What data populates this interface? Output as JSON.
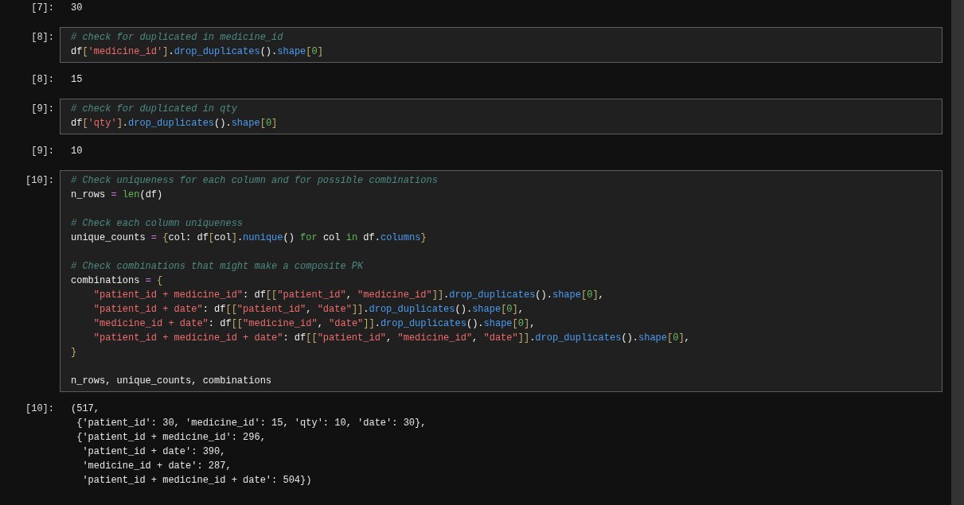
{
  "cells": [
    {
      "kind": "output",
      "prompt": "[7]:",
      "lines": [
        "30"
      ]
    },
    {
      "kind": "input",
      "prompt": "[8]:",
      "blocks": [
        {
          "lines": [
            {
              "tokens": [
                {
                  "kind": "comment",
                  "text": "# check for duplicated in medicine_id"
                }
              ]
            },
            {
              "tokens": [
                {
                  "kind": "name",
                  "text": "df"
                },
                {
                  "kind": "bracket",
                  "text": "["
                },
                {
                  "kind": "string",
                  "text": "'medicine_id'"
                },
                {
                  "kind": "bracket",
                  "text": "]"
                },
                {
                  "kind": "name",
                  "text": "."
                },
                {
                  "kind": "attr",
                  "text": "drop_duplicates"
                },
                {
                  "kind": "name",
                  "text": "()."
                },
                {
                  "kind": "attr",
                  "text": "shape"
                },
                {
                  "kind": "bracket",
                  "text": "["
                },
                {
                  "kind": "number",
                  "text": "0"
                },
                {
                  "kind": "bracket",
                  "text": "]"
                }
              ]
            }
          ]
        }
      ]
    },
    {
      "kind": "output",
      "prompt": "[8]:",
      "lines": [
        "15"
      ]
    },
    {
      "kind": "input",
      "prompt": "[9]:",
      "blocks": [
        {
          "lines": [
            {
              "tokens": [
                {
                  "kind": "comment",
                  "text": "# check for duplicated in qty"
                }
              ]
            },
            {
              "tokens": [
                {
                  "kind": "name",
                  "text": "df"
                },
                {
                  "kind": "bracket",
                  "text": "["
                },
                {
                  "kind": "string",
                  "text": "'qty'"
                },
                {
                  "kind": "bracket",
                  "text": "]"
                },
                {
                  "kind": "name",
                  "text": "."
                },
                {
                  "kind": "attr",
                  "text": "drop_duplicates"
                },
                {
                  "kind": "name",
                  "text": "()."
                },
                {
                  "kind": "attr",
                  "text": "shape"
                },
                {
                  "kind": "bracket",
                  "text": "["
                },
                {
                  "kind": "number",
                  "text": "0"
                },
                {
                  "kind": "bracket",
                  "text": "]"
                }
              ]
            }
          ]
        }
      ]
    },
    {
      "kind": "output",
      "prompt": "[9]:",
      "lines": [
        "10"
      ]
    },
    {
      "kind": "input",
      "prompt": "[10]:",
      "blocks": [
        {
          "lines": [
            {
              "tokens": [
                {
                  "kind": "comment",
                  "text": "# Check uniqueness for each column and for possible combinations"
                }
              ]
            },
            {
              "tokens": [
                {
                  "kind": "name",
                  "text": "n_rows "
                },
                {
                  "kind": "operator",
                  "text": "= "
                },
                {
                  "kind": "builtin",
                  "text": "len"
                },
                {
                  "kind": "name",
                  "text": "(df)"
                }
              ]
            }
          ]
        },
        {
          "lines": [
            {
              "tokens": [
                {
                  "kind": "comment",
                  "text": "# Check each column uniqueness"
                }
              ]
            },
            {
              "tokens": [
                {
                  "kind": "name",
                  "text": "unique_counts "
                },
                {
                  "kind": "operator",
                  "text": "= "
                },
                {
                  "kind": "bracket",
                  "text": "{"
                },
                {
                  "kind": "name",
                  "text": "col: df"
                },
                {
                  "kind": "bracket",
                  "text": "["
                },
                {
                  "kind": "name",
                  "text": "col"
                },
                {
                  "kind": "bracket",
                  "text": "]"
                },
                {
                  "kind": "name",
                  "text": "."
                },
                {
                  "kind": "attr",
                  "text": "nunique"
                },
                {
                  "kind": "name",
                  "text": "() "
                },
                {
                  "kind": "keyword",
                  "text": "for"
                },
                {
                  "kind": "name",
                  "text": " col "
                },
                {
                  "kind": "keyword",
                  "text": "in"
                },
                {
                  "kind": "name",
                  "text": " df."
                },
                {
                  "kind": "attr",
                  "text": "columns"
                },
                {
                  "kind": "bracket",
                  "text": "}"
                }
              ]
            }
          ]
        },
        {
          "lines": [
            {
              "tokens": [
                {
                  "kind": "comment",
                  "text": "# Check combinations that might make a composite PK"
                }
              ]
            },
            {
              "tokens": [
                {
                  "kind": "name",
                  "text": "combinations "
                },
                {
                  "kind": "operator",
                  "text": "= "
                },
                {
                  "kind": "bracket",
                  "text": "{"
                }
              ]
            },
            {
              "indented": true,
              "tokens": [
                {
                  "kind": "string",
                  "text": "\"patient_id + medicine_id\""
                },
                {
                  "kind": "name",
                  "text": ": df"
                },
                {
                  "kind": "bracket",
                  "text": "[["
                },
                {
                  "kind": "string",
                  "text": "\"patient_id\""
                },
                {
                  "kind": "name",
                  "text": ", "
                },
                {
                  "kind": "string",
                  "text": "\"medicine_id\""
                },
                {
                  "kind": "bracket",
                  "text": "]]"
                },
                {
                  "kind": "name",
                  "text": "."
                },
                {
                  "kind": "attr",
                  "text": "drop_duplicates"
                },
                {
                  "kind": "name",
                  "text": "()."
                },
                {
                  "kind": "attr",
                  "text": "shape"
                },
                {
                  "kind": "bracket",
                  "text": "["
                },
                {
                  "kind": "number",
                  "text": "0"
                },
                {
                  "kind": "bracket",
                  "text": "]"
                },
                {
                  "kind": "name",
                  "text": ","
                }
              ]
            },
            {
              "indented": true,
              "tokens": [
                {
                  "kind": "string",
                  "text": "\"patient_id + date\""
                },
                {
                  "kind": "name",
                  "text": ": df"
                },
                {
                  "kind": "bracket",
                  "text": "[["
                },
                {
                  "kind": "string",
                  "text": "\"patient_id\""
                },
                {
                  "kind": "name",
                  "text": ", "
                },
                {
                  "kind": "string",
                  "text": "\"date\""
                },
                {
                  "kind": "bracket",
                  "text": "]]"
                },
                {
                  "kind": "name",
                  "text": "."
                },
                {
                  "kind": "attr",
                  "text": "drop_duplicates"
                },
                {
                  "kind": "name",
                  "text": "()."
                },
                {
                  "kind": "attr",
                  "text": "shape"
                },
                {
                  "kind": "bracket",
                  "text": "["
                },
                {
                  "kind": "number",
                  "text": "0"
                },
                {
                  "kind": "bracket",
                  "text": "]"
                },
                {
                  "kind": "name",
                  "text": ","
                }
              ]
            },
            {
              "indented": true,
              "tokens": [
                {
                  "kind": "string",
                  "text": "\"medicine_id + date\""
                },
                {
                  "kind": "name",
                  "text": ": df"
                },
                {
                  "kind": "bracket",
                  "text": "[["
                },
                {
                  "kind": "string",
                  "text": "\"medicine_id\""
                },
                {
                  "kind": "name",
                  "text": ", "
                },
                {
                  "kind": "string",
                  "text": "\"date\""
                },
                {
                  "kind": "bracket",
                  "text": "]]"
                },
                {
                  "kind": "name",
                  "text": "."
                },
                {
                  "kind": "attr",
                  "text": "drop_duplicates"
                },
                {
                  "kind": "name",
                  "text": "()."
                },
                {
                  "kind": "attr",
                  "text": "shape"
                },
                {
                  "kind": "bracket",
                  "text": "["
                },
                {
                  "kind": "number",
                  "text": "0"
                },
                {
                  "kind": "bracket",
                  "text": "]"
                },
                {
                  "kind": "name",
                  "text": ","
                }
              ]
            },
            {
              "indented": true,
              "tokens": [
                {
                  "kind": "string",
                  "text": "\"patient_id + medicine_id + date\""
                },
                {
                  "kind": "name",
                  "text": ": df"
                },
                {
                  "kind": "bracket",
                  "text": "[["
                },
                {
                  "kind": "string",
                  "text": "\"patient_id\""
                },
                {
                  "kind": "name",
                  "text": ", "
                },
                {
                  "kind": "string",
                  "text": "\"medicine_id\""
                },
                {
                  "kind": "name",
                  "text": ", "
                },
                {
                  "kind": "string",
                  "text": "\"date\""
                },
                {
                  "kind": "bracket",
                  "text": "]]"
                },
                {
                  "kind": "name",
                  "text": "."
                },
                {
                  "kind": "attr",
                  "text": "drop_duplicates"
                },
                {
                  "kind": "name",
                  "text": "()."
                },
                {
                  "kind": "attr",
                  "text": "shape"
                },
                {
                  "kind": "bracket",
                  "text": "["
                },
                {
                  "kind": "number",
                  "text": "0"
                },
                {
                  "kind": "bracket",
                  "text": "]"
                },
                {
                  "kind": "name",
                  "text": ","
                }
              ]
            },
            {
              "tokens": [
                {
                  "kind": "bracket",
                  "text": "}"
                }
              ]
            }
          ]
        },
        {
          "lines": [
            {
              "tokens": [
                {
                  "kind": "name",
                  "text": "n_rows, unique_counts, combinations"
                }
              ]
            }
          ]
        }
      ]
    },
    {
      "kind": "output",
      "prompt": "[10]:",
      "lines": [
        "(517,",
        " {'patient_id': 30, 'medicine_id': 15, 'qty': 10, 'date': 30},",
        " {'patient_id + medicine_id': 296,",
        "  'patient_id + date': 390,",
        "  'medicine_id + date': 287,",
        "  'patient_id + medicine_id + date': 504})"
      ]
    }
  ]
}
